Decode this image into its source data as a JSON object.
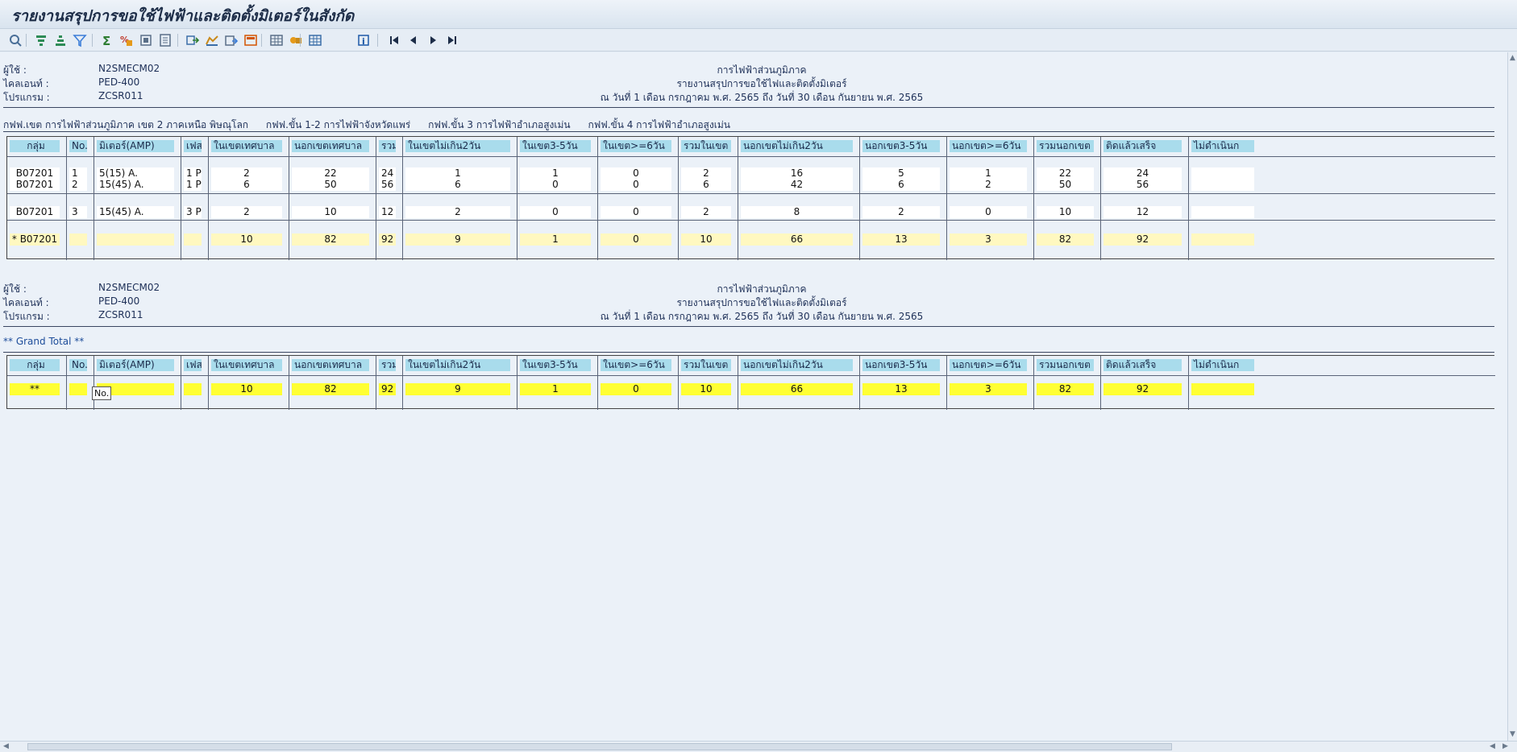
{
  "window": {
    "title": "รายงานสรุปการขอใช้ไฟฟ้าและติดตั้งมิเตอร์ในสังกัด"
  },
  "toolbar": {
    "icons": [
      "details-icon",
      "sort-ascending-icon",
      "sort-descending-icon",
      "filter-icon",
      "sum-icon",
      "subtotal-icon",
      "print-preview-icon",
      "export-icon",
      "send-icon",
      "local-file-icon",
      "abc-analysis-icon",
      "graphic-icon",
      "save-layout-icon",
      "change-layout-icon",
      "select-layout-icon",
      "info-icon",
      "first-page-icon",
      "previous-page-icon",
      "next-page-icon",
      "last-page-icon"
    ]
  },
  "report_header": {
    "user_label": "ผู้ใช้    :",
    "user_value": "N2SMECM02",
    "client_label": "ไคลเอนท์  :",
    "client_value": "PED-400",
    "program_label": "โปรแกรม   :",
    "program_value": "ZCSR011",
    "org": "การไฟฟ้าส่วนภูมิภาค",
    "report_title": "รายงานสรุปการขอใช้ไฟและติดตั้งมิเตอร์",
    "period": "ณ วันที่ 1 เดือน กรกฎาคม พ.ศ. 2565 ถึง วันที่ 30 เดือน กันยายน พ.ศ. 2565"
  },
  "district_line": [
    "กฟฟ.เขต การไฟฟ้าส่วนภูมิภาค เขต 2 ภาคเหนือ พิษณุโลก",
    "กฟฟ.ขั้น 1-2 การไฟฟ้าจังหวัดแพร่",
    "กฟฟ.ขั้น 3 การไฟฟ้าอำเภอสูงเม่น",
    "กฟฟ.ขั้น 4 การไฟฟ้าอำเภอสูงเม่น"
  ],
  "grand_total_label": "** Grand Total **",
  "columns": [
    "กลุ่ม",
    "No.",
    "มิเตอร์(AMP)",
    "เฟส",
    "ในเขตเทศบาล",
    "นอกเขตเทศบาล",
    "รวม",
    "ในเขตไม่เกิน2วัน",
    "ในเขต3-5วัน",
    "ในเขต>=6วัน",
    "รวมในเขต",
    "นอกเขตไม่เกิน2วัน",
    "นอกเขต3-5วัน",
    "นอกเขต>=6วัน",
    "รวมนอกเขต",
    "ติดแล้วเสร็จ",
    "ไม่ดำเนินก"
  ],
  "rows": [
    [
      "B07201",
      "1",
      "5(15) A.",
      "1 P",
      "2",
      "22",
      "24",
      "1",
      "1",
      "0",
      "2",
      "16",
      "5",
      "1",
      "22",
      "24",
      ""
    ],
    [
      "B07201",
      "2",
      "15(45) A.",
      "1 P",
      "6",
      "50",
      "56",
      "6",
      "0",
      "0",
      "6",
      "42",
      "6",
      "2",
      "50",
      "56",
      ""
    ],
    [
      "B07201",
      "3",
      "15(45) A.",
      "3 P",
      "2",
      "10",
      "12",
      "2",
      "0",
      "0",
      "2",
      "8",
      "2",
      "0",
      "10",
      "12",
      ""
    ]
  ],
  "subtotal_row": [
    "*  B07201",
    "",
    "",
    "",
    "10",
    "82",
    "92",
    "9",
    "1",
    "0",
    "10",
    "66",
    "13",
    "3",
    "82",
    "92",
    ""
  ],
  "grandtotal_row": [
    "**",
    "",
    "",
    "",
    "10",
    "82",
    "92",
    "9",
    "1",
    "0",
    "10",
    "66",
    "13",
    "3",
    "82",
    "92",
    ""
  ],
  "tooltip": "No."
}
